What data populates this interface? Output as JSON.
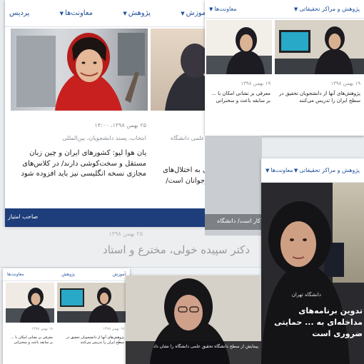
{
  "main_page": {
    "nav": [
      {
        "label": "آموزش"
      },
      {
        "label": "پژوهش"
      },
      {
        "label": "معاونت‌ها"
      },
      {
        "label": "پردیس"
      }
    ],
    "article": {
      "date": "۲۵ بهمن ۱۳۹۸، ۱۴:۰۰",
      "category": "انتخاب، پسند دانشجویان، بین‌المللی",
      "body": "یان هوا لیو: کشورهای ایران و چین زبان مستقل و سخت‌کوشی دارند/ در کلاس‌های مجازی نسخه انگلیسی نیز باید افزوده شود"
    },
    "second_article": {
      "tag": "از علمی دانشگاه",
      "body": "بی به اختلال‌های نوجوانان است/"
    },
    "footer_bar": {
      "text": "صاحب امتیاز"
    }
  },
  "mid_strip": {
    "date_line": "۲۵ بهمن ۱۳۹۸",
    "headline": "دکتر سپیده خولی، مخترع و استاد"
  },
  "top_right_shot": {
    "nav": [
      {
        "label": "پژوهش و مراکز تحقیقاتی"
      },
      {
        "label": "معاونت‌ها"
      }
    ],
    "card_a": {
      "date": "۱۹ بهمن ۱۳۹۸",
      "body": "معرفی بر نشانی امکان با ...  بر سابقه باعث و سخنرانی"
    },
    "card_b": {
      "date": "۱۹ بهمن ۱۳۹۸",
      "body": "پژوهش‌های آنها از دانشجویان تحقیق در سطح ایران را تدریس می‌کنند"
    },
    "overlay": "کار است/ دانشگاه"
  },
  "right_shot": {
    "nav": [
      {
        "label": "پژوهش و مراکز تحقیقاتی"
      },
      {
        "label": "معاونت‌ها"
      }
    ],
    "caption_small": "دانشگاه تهران",
    "caption": "تدوین برنامه‌های مداخله‌ای به ... حمایتی ضروری است"
  },
  "bottom_center_shot": {
    "caption": "پیمایش از سطح دانشگاه تحقیق علمی دانشگاه را نشان داد"
  },
  "colors": {
    "nav_blue": "#1e4f9a",
    "bar_navy": "#1e3d7b",
    "hijab_red": "#c8201e"
  }
}
